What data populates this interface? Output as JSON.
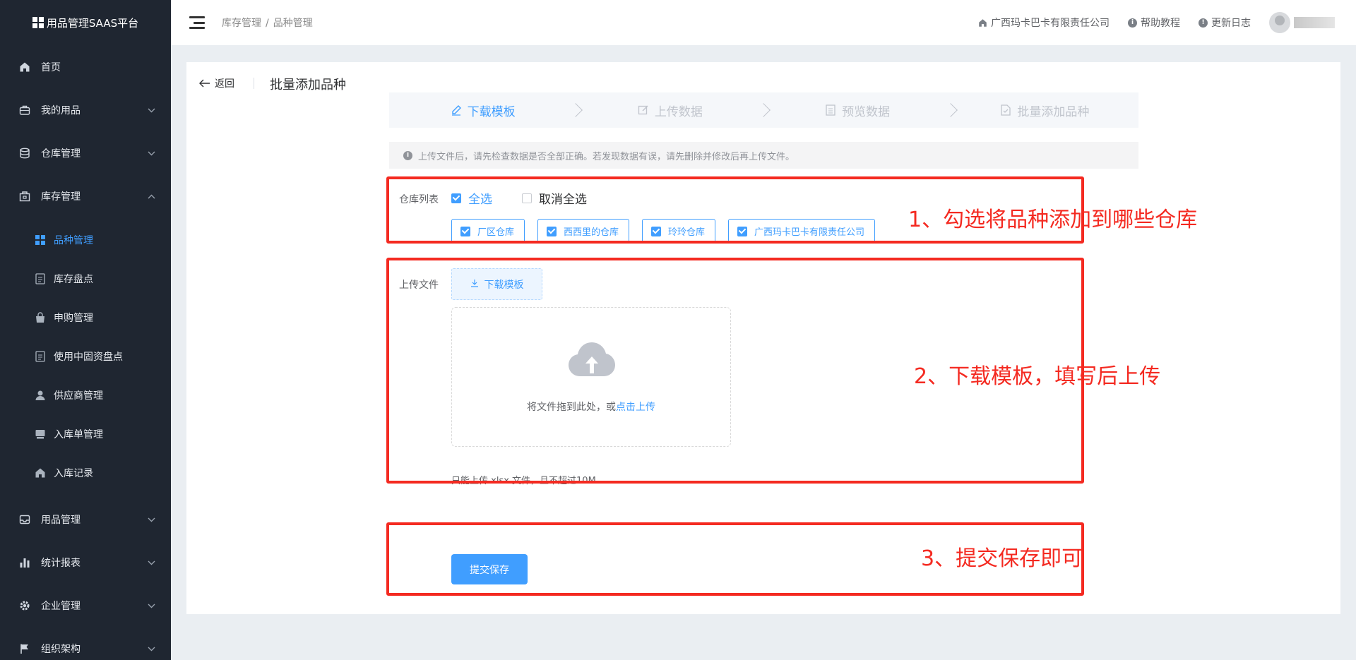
{
  "sidebar": {
    "brand": "用品管理SAAS平台",
    "menu": [
      {
        "label": "首页",
        "icon": "home-icon"
      },
      {
        "label": "我的用品",
        "icon": "briefcase-icon"
      },
      {
        "label": "仓库管理",
        "icon": "database-icon"
      },
      {
        "label": "库存管理",
        "icon": "store-icon"
      }
    ],
    "sub_items": [
      {
        "label": "品种管理",
        "icon": "grid-icon",
        "active": true
      },
      {
        "label": "库存盘点",
        "icon": "document-icon"
      },
      {
        "label": "申购管理",
        "icon": "bag-icon"
      },
      {
        "label": "使用中固资盘点",
        "icon": "document-icon"
      },
      {
        "label": "供应商管理",
        "icon": "user-icon"
      },
      {
        "label": "入库单管理",
        "icon": "inbox-icon"
      },
      {
        "label": "入库记录",
        "icon": "home-icon"
      }
    ],
    "menu_bottom": [
      {
        "label": "用品管理",
        "icon": "tray-icon"
      },
      {
        "label": "统计报表",
        "icon": "bar-chart-icon"
      },
      {
        "label": "企业管理",
        "icon": "gear-icon"
      },
      {
        "label": "组织架构",
        "icon": "flag-icon"
      }
    ]
  },
  "header": {
    "breadcrumb": [
      "库存管理",
      "品种管理"
    ],
    "breadcrumb_sep": "/",
    "company": "广西玛卡巴卡有限责任公司",
    "help": "帮助教程",
    "changelog": "更新日志"
  },
  "page": {
    "back_label": "返回",
    "title": "批量添加品种",
    "steps": [
      "下载模板",
      "上传数据",
      "预览数据",
      "批量添加品种"
    ],
    "active_step": 0,
    "alert": "上传文件后，请先检查数据是否全部正确。若发现数据有误，请先删除并修改后再上传文件。",
    "warehouse_label": "仓库列表",
    "select_all": "全选",
    "deselect_all": "取消全选",
    "warehouses": [
      "厂区仓库",
      "西西里的仓库",
      "玲玲仓库",
      "广西玛卡巴卡有限责任公司"
    ],
    "upload_label": "上传文件",
    "download_template": "下载模板",
    "drop_text": "将文件拖到此处，或",
    "drop_link": "点击上传",
    "tip": "只能上传 xlsx 文件，且不超过10M",
    "submit": "提交保存"
  },
  "annotations": {
    "a1": "1、勾选将品种添加到哪些仓库",
    "a2": "2、下载模板，填写后上传",
    "a3": "3、提交保存即可"
  },
  "colors": {
    "primary": "#409eff",
    "sidebar_bg": "#1f2631",
    "annotation_red": "#f42a21"
  }
}
